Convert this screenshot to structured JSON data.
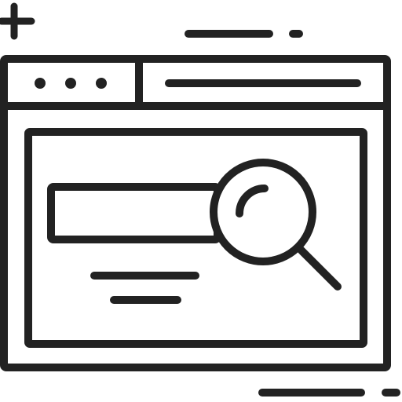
{
  "colors": {
    "ink": "#222222",
    "background": "#ffffff"
  },
  "icons": {
    "illustration": "browser-search-icon",
    "plus": "plus-icon",
    "magnifier": "magnifying-glass-icon"
  },
  "browser": {
    "dot_count": 3,
    "address_bar_icon": "address-bar-line",
    "search_field_icon": "search-field-outline",
    "result_lines": 2
  }
}
